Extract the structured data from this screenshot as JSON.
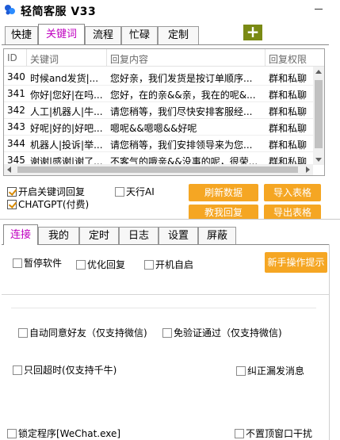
{
  "app": {
    "title": "轻简客服 V33"
  },
  "top_tabs": [
    "快捷",
    "关键词",
    "流程",
    "忙碌",
    "定制"
  ],
  "plus_label": "+",
  "table": {
    "headers": [
      "ID",
      "关键词",
      "回复内容",
      "回复权限"
    ],
    "rows": [
      [
        "340",
        "时候and发货|...",
        "您好亲，我们发货是按订单顺序...",
        "群和私聊"
      ],
      [
        "341",
        "你好|您好|在吗...",
        "您好，在的亲&&亲，我在的呢&...",
        "群和私聊"
      ],
      [
        "342",
        "人工|机器人|牛...",
        "请您稍等，我们尽快安排客服经...",
        "群和私聊"
      ],
      [
        "343",
        "好呢|好的|好吧...",
        "嗯呢&&嗯嗯&&好呢",
        "群和私聊"
      ],
      [
        "344",
        "机器人|投诉|举...",
        "请您稍等，我们安排领导来为您...",
        "群和私聊"
      ],
      [
        "345",
        "谢谢|感谢|谢了...",
        "不客气的哦亲&&没事的呢，很荣...",
        "群和私聊"
      ]
    ]
  },
  "options": {
    "keyword_reply": "开启关键词回复",
    "chatgpt": "CHATGPT(付费)",
    "tianxing": "天行AI"
  },
  "buttons": {
    "refresh": "刷新数据",
    "import": "导入表格",
    "teach": "教我回复",
    "export": "导出表格",
    "beginner": "新手操作提示"
  },
  "bottom_tabs": [
    "连接",
    "我的",
    "定时",
    "日志",
    "设置",
    "屏蔽"
  ],
  "settings": {
    "pause": "暂停软件",
    "optimize": "优化回复",
    "autostart": "开机自启",
    "auto_friend": "自动同意好友（仅支持微信)",
    "no_verify": "免验证通过（仅支持微信)",
    "timeout_only": "只回超时(仅支持千牛)",
    "fix_leak": "纠正漏发消息",
    "lock_program": "锁定程序[WeChat.exe]",
    "no_topmost": "不置顶窗口干扰"
  },
  "colors": {
    "accent": "#f5a623",
    "active_tab": "#c000c0",
    "plus": "#7a8a14"
  }
}
